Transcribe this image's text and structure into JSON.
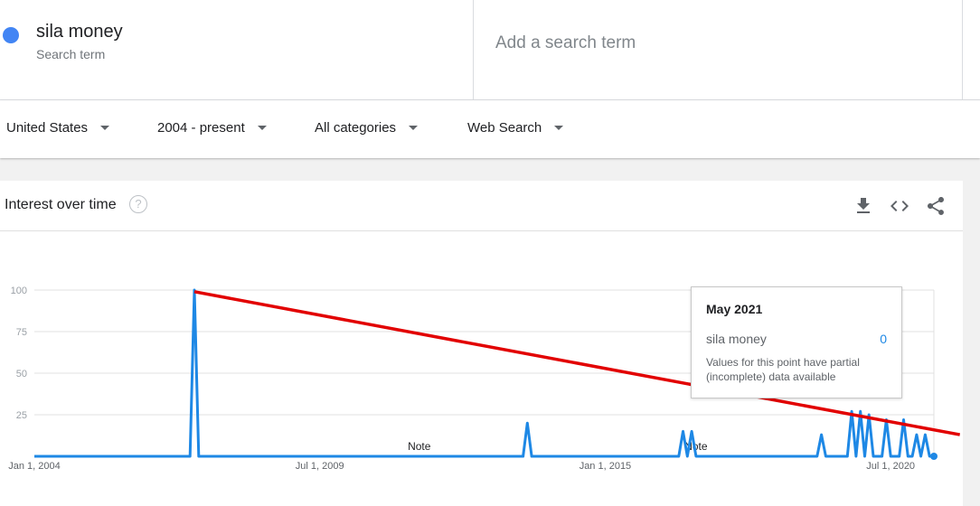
{
  "search_term": {
    "name": "sila money",
    "subtitle": "Search term",
    "color": "#4285f4"
  },
  "add_term": {
    "placeholder": "Add a search term"
  },
  "filters": [
    {
      "label": "United States"
    },
    {
      "label": "2004 - present"
    },
    {
      "label": "All categories"
    },
    {
      "label": "Web Search"
    }
  ],
  "panel": {
    "title": "Interest over time",
    "help_icon": "?"
  },
  "tooltip": {
    "date": "May 2021",
    "series_name": "sila money",
    "value": "0",
    "note": "Values for this point have partial (incomplete) data available"
  },
  "colors": {
    "series": "#1e88e5",
    "trend_line": "#e20000",
    "grid": "#e0e0e0"
  },
  "chart_data": {
    "type": "line",
    "title": "",
    "x_ticks": [
      "Jan 1, 2004",
      "Jul 1, 2009",
      "Jan 1, 2015",
      "Jul 1, 2020"
    ],
    "x_range": [
      "2004-01",
      "2021-05"
    ],
    "y_ticks": [
      100,
      75,
      50,
      25
    ],
    "ylim": [
      0,
      100
    ],
    "grid": true,
    "annotations": [
      {
        "label": "Note",
        "date": "2011-06"
      },
      {
        "label": "Note",
        "date": "2016-10"
      }
    ],
    "series": [
      {
        "name": "sila money",
        "baseline": 0,
        "points": [
          {
            "date": "2007-01",
            "value": 0
          },
          {
            "date": "2007-02",
            "value": 100
          },
          {
            "date": "2007-03",
            "value": 0
          },
          {
            "date": "2013-06",
            "value": 0
          },
          {
            "date": "2013-07",
            "value": 20
          },
          {
            "date": "2013-08",
            "value": 0
          },
          {
            "date": "2016-06",
            "value": 0
          },
          {
            "date": "2016-07",
            "value": 15
          },
          {
            "date": "2016-08",
            "value": 0
          },
          {
            "date": "2016-09",
            "value": 15
          },
          {
            "date": "2016-10",
            "value": 0
          },
          {
            "date": "2019-02",
            "value": 0
          },
          {
            "date": "2019-03",
            "value": 13
          },
          {
            "date": "2019-04",
            "value": 0
          },
          {
            "date": "2019-09",
            "value": 0
          },
          {
            "date": "2019-10",
            "value": 27
          },
          {
            "date": "2019-11",
            "value": 0
          },
          {
            "date": "2019-12",
            "value": 27
          },
          {
            "date": "2020-01",
            "value": 0
          },
          {
            "date": "2020-02",
            "value": 25
          },
          {
            "date": "2020-03",
            "value": 0
          },
          {
            "date": "2020-05",
            "value": 0
          },
          {
            "date": "2020-06",
            "value": 22
          },
          {
            "date": "2020-07",
            "value": 0
          },
          {
            "date": "2020-09",
            "value": 0
          },
          {
            "date": "2020-10",
            "value": 22
          },
          {
            "date": "2020-11",
            "value": 0
          },
          {
            "date": "2020-12",
            "value": 0
          },
          {
            "date": "2021-01",
            "value": 13
          },
          {
            "date": "2021-02",
            "value": 0
          },
          {
            "date": "2021-03",
            "value": 13
          },
          {
            "date": "2021-04",
            "value": 0
          },
          {
            "date": "2021-05",
            "value": 0
          }
        ]
      }
    ],
    "trend_line": {
      "from": {
        "date": "2007-02",
        "value": 99
      },
      "to": {
        "date": "2021-11",
        "value": 13
      }
    }
  }
}
